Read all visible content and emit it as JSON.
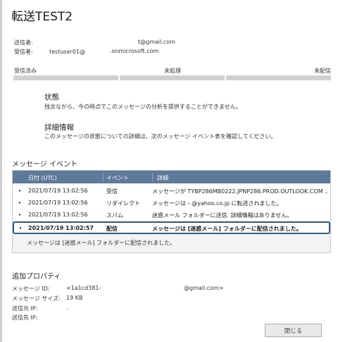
{
  "title": "転送TEST2",
  "sender": {
    "label": "送信者:",
    "value_tail": "t@gmail.com"
  },
  "recipient": {
    "label": "受信者:",
    "value": "testuser01@",
    "value_tail": ".onmicrosoft.com"
  },
  "status": {
    "received": "受信済み",
    "pending": "未処理",
    "undelivered": "未配信"
  },
  "status_section": {
    "heading": "状態",
    "text": "残念ながら、今の時点でこのメッセージの分析を提供することができません。"
  },
  "detail_section": {
    "heading": "詳細情報",
    "text": "このメッセージの状態についての詳細は、次のメッセージ イベント表を確認してください。"
  },
  "events": {
    "title": "メッセージ イベント",
    "headers": {
      "date": "日付 (UTC)",
      "event": "イベント",
      "detail": "詳細"
    },
    "rows": [
      {
        "arrow": "▸",
        "date": "2021/07/19 13:02:56",
        "event": "受信",
        "detail": "メッセージが TYBP286MB0222.JPNP286.PROD.OUTLOOK.COM ..."
      },
      {
        "arrow": "▸",
        "date": "2021/07/19 13:02:56",
        "event": "リダイレクト",
        "detail": "メッセージは ‹              @yahoo.co.jp に転送されました。"
      },
      {
        "arrow": "▸",
        "date": "2021/07/19 13:02:56",
        "event": "スパム",
        "detail": "迷惑メール フォルダーに送信. 詳細情報はありません。"
      },
      {
        "arrow": "◂",
        "date": "2021/07/19 13:02:57",
        "event": "配信",
        "detail": "メッセージは [迷惑メール] フォルダーに配信されました。"
      }
    ],
    "expanded_text": "メッセージは [迷惑メール] フォルダーに配信されました。"
  },
  "properties": {
    "title": "追加プロパティ",
    "message_id": {
      "label": "メッセージ ID:",
      "value": "<1a1cd381-",
      "value_tail": "@gmail.com>"
    },
    "size": {
      "label": "メッセージ サイズ:",
      "value": "19 KB"
    },
    "source_ip": {
      "label": "送信元 IP:",
      "value": "."
    },
    "dest_ip": {
      "label": "送信先 IP:"
    }
  },
  "close_button": "閉じる"
}
